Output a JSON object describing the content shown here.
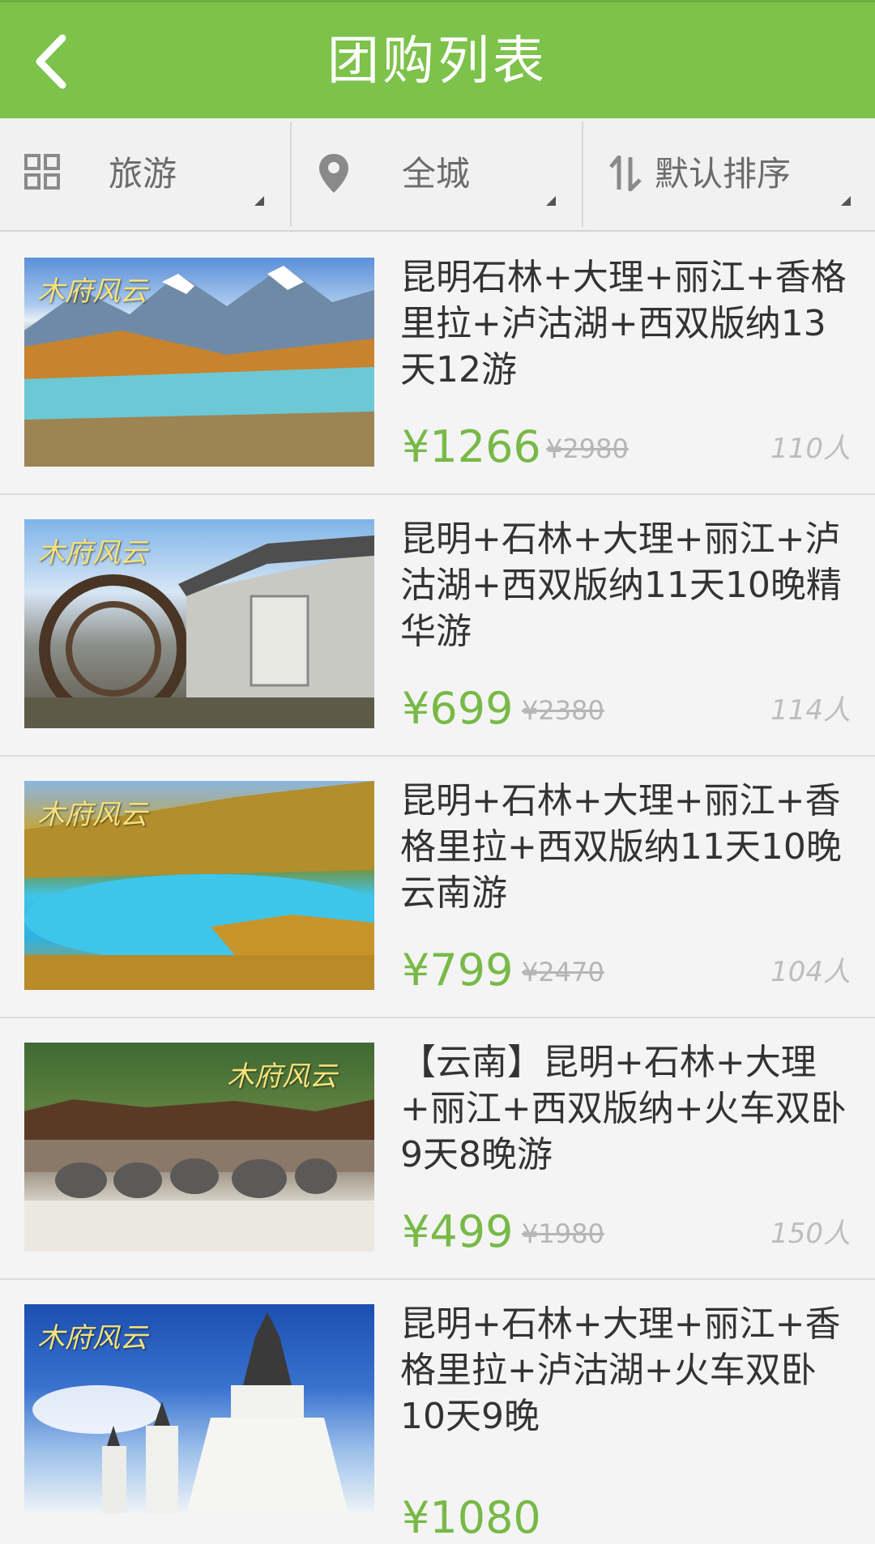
{
  "header": {
    "title": "团购列表",
    "back_icon": "chevron-left-icon"
  },
  "filters": [
    {
      "label": "旅游",
      "icon": "grid-icon"
    },
    {
      "label": "全城",
      "icon": "location-pin-icon"
    },
    {
      "label": "默认排序",
      "icon": "sort-icon"
    }
  ],
  "items": [
    {
      "title": "昆明石林+大理+丽江+香格里拉+泸沽湖+西双版纳13天12游",
      "price": "¥1266",
      "original_price": "¥2980",
      "count": "110人",
      "watermark": "木府风云"
    },
    {
      "title": "昆明+石林+大理+丽江+泸沽湖+西双版纳11天10晚精华游",
      "price": "¥699",
      "original_price": "¥2380",
      "count": "114人",
      "watermark": "木府风云"
    },
    {
      "title": "昆明+石林+大理+丽江+香格里拉+西双版纳11天10晚云南游",
      "price": "¥799",
      "original_price": "¥2470",
      "count": "104人",
      "watermark": "木府风云"
    },
    {
      "title": "【云南】昆明+石林+大理+丽江+西双版纳+火车双卧9天8晚游",
      "price": "¥499",
      "original_price": "¥1980",
      "count": "150人",
      "watermark": "木府风云"
    },
    {
      "title": "昆明+石林+大理+丽江+香格里拉+泸沽湖+火车双卧10天9晚",
      "price": "¥1080",
      "original_price": "",
      "count": "",
      "watermark": "木府风云"
    }
  ],
  "colors": {
    "accent": "#7dc24b",
    "price": "#78b947"
  }
}
